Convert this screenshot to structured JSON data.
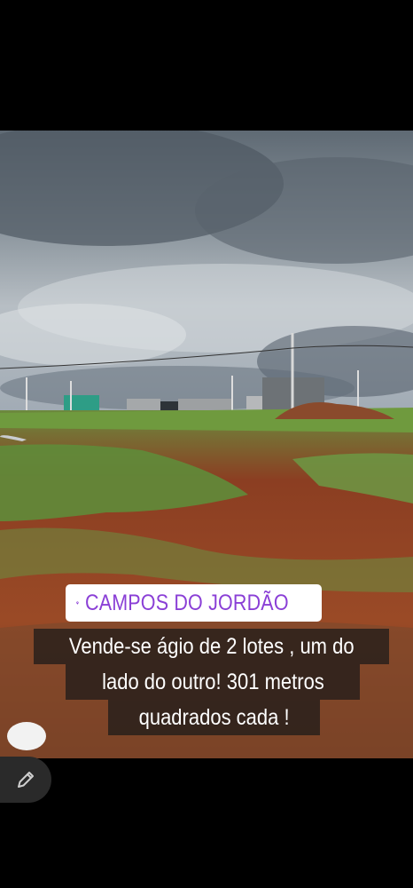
{
  "story": {
    "location_sticker": {
      "label": "CAMPOS DO JORDÃO",
      "color": "#8a3fd6"
    },
    "caption_lines": [
      "Vende-se ágio de 2 lotes , um do",
      "lado do outro! 301 metros",
      "quadrados cada !"
    ]
  },
  "icons": {
    "location": "map-pin-icon",
    "edit": "pencil-icon"
  }
}
